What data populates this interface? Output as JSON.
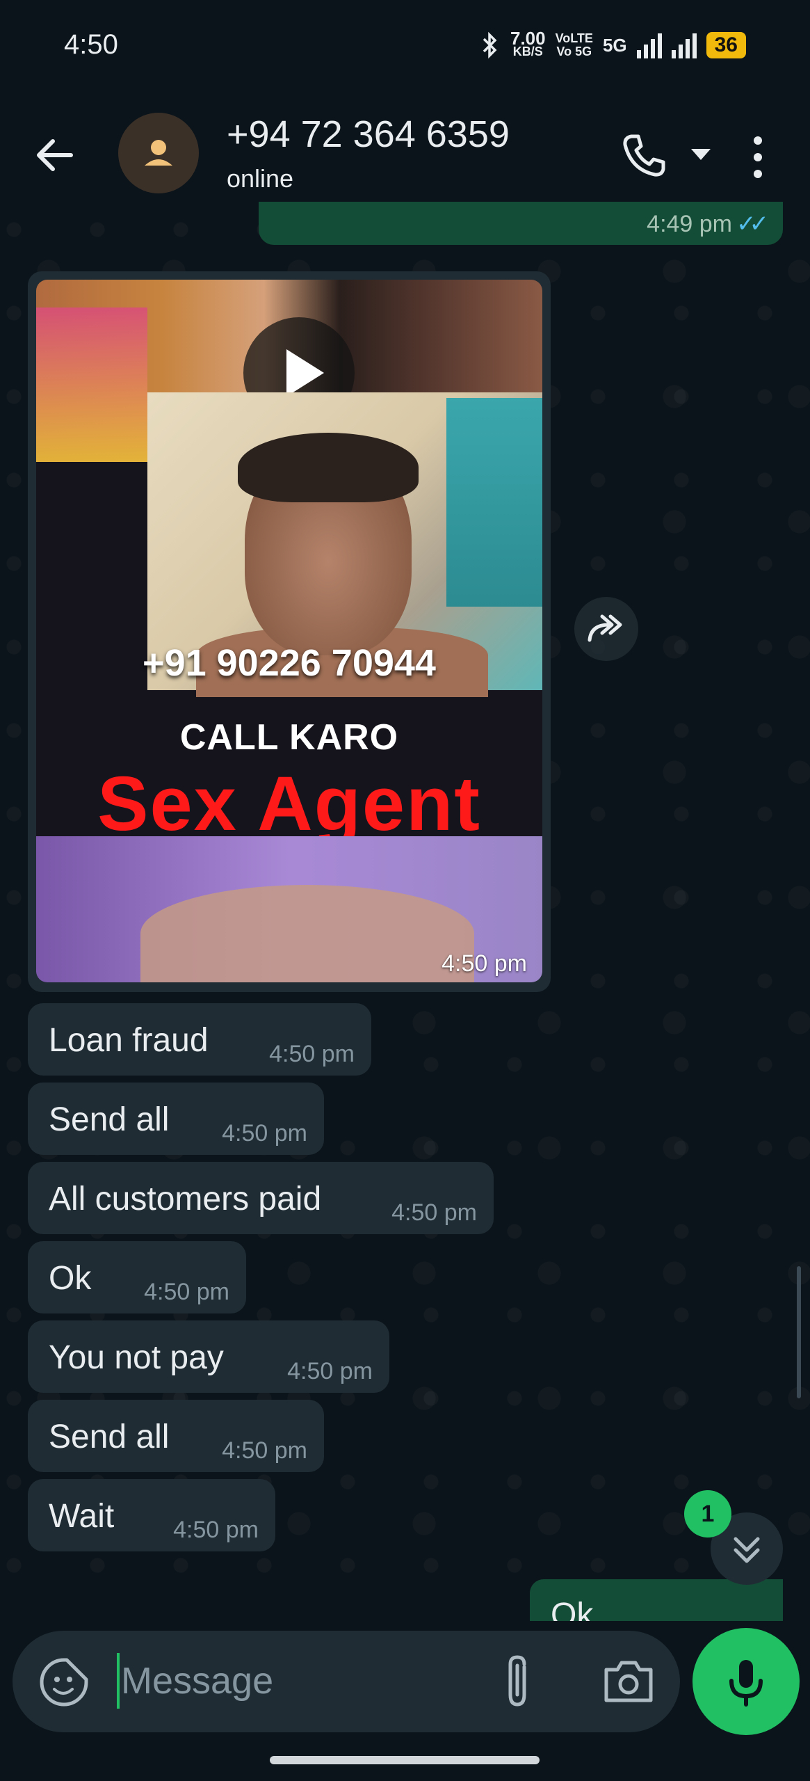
{
  "status_bar": {
    "time": "4:50",
    "net_speed_value": "7.00",
    "net_speed_unit": "KB/S",
    "volte_line1": "VoLTE",
    "volte_line2": "Vo 5G",
    "network_type": "5G",
    "battery": "36"
  },
  "header": {
    "contact_name": "+94 72 364 6359",
    "contact_status": "online"
  },
  "messages": {
    "previous_outgoing_time": "4:49 pm",
    "media": {
      "overlay_phone": "+91 90226 70944",
      "overlay_line1": "CALL KARO",
      "overlay_line2": "Sex Agent",
      "time": "4:50 pm"
    },
    "incoming": [
      {
        "text": "Loan fraud",
        "time": "4:50 pm"
      },
      {
        "text": "Send all",
        "time": "4:50 pm"
      },
      {
        "text": "All customers paid",
        "time": "4:50 pm"
      },
      {
        "text": "Ok",
        "time": "4:50 pm"
      },
      {
        "text": "You not pay",
        "time": "4:50 pm"
      },
      {
        "text": "Send all",
        "time": "4:50 pm"
      },
      {
        "text": "Wait",
        "time": "4:50 pm"
      }
    ],
    "last_outgoing_text": "Ok"
  },
  "scroll": {
    "unread_count": "1"
  },
  "input": {
    "placeholder": "Message"
  },
  "colors": {
    "background": "#0b141a",
    "incoming_bubble": "#1f2c34",
    "outgoing_bubble": "#144d37",
    "accent": "#21c063",
    "read_ticks": "#53bdeb"
  }
}
